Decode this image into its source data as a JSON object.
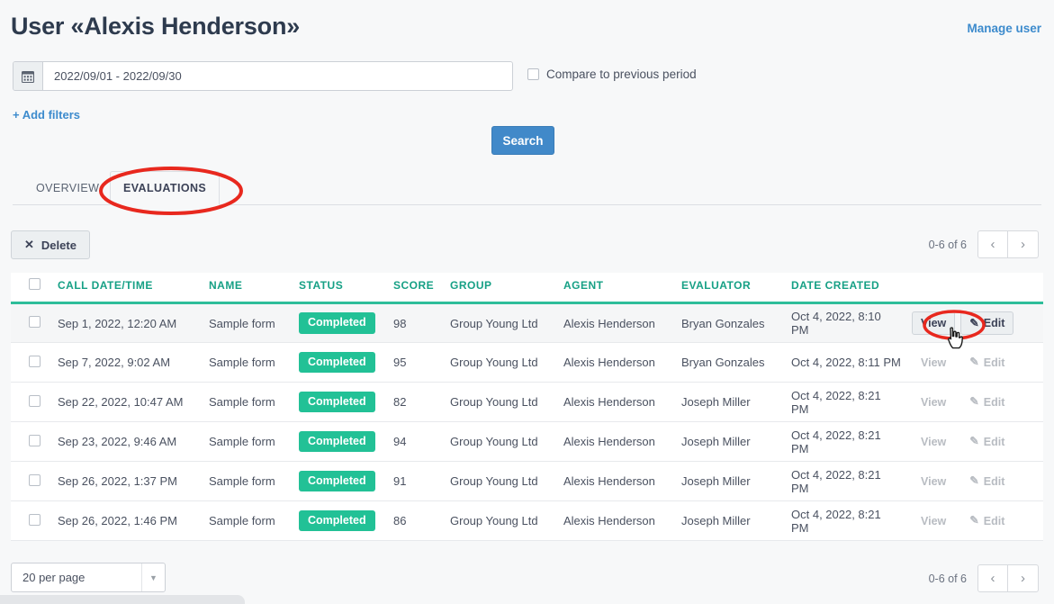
{
  "header": {
    "title": "User «Alexis Henderson»",
    "manage_user_label": "Manage user"
  },
  "filters": {
    "date_range_value": "2022/09/01 - 2022/09/30",
    "date_range_placeholder": "2022/09/01 - 2022/09/30",
    "calendar_icon": "calendar-icon",
    "compare_label": "Compare to previous period",
    "compare_checked": false,
    "add_filters_label": "+ Add filters",
    "search_label": "Search"
  },
  "tabs": [
    {
      "label": "OVERVIEW",
      "active": false
    },
    {
      "label": "EVALUATIONS",
      "active": true
    }
  ],
  "toolbar": {
    "delete_label": "Delete",
    "delete_icon": "x-icon"
  },
  "pagination": {
    "count_label": "0-6 of 6",
    "prev_icon": "chevron-left-icon",
    "next_icon": "chevron-right-icon",
    "per_page_label": "20 per page",
    "per_page_caret": "caret-down-icon"
  },
  "table": {
    "columns": [
      "CALL DATE/TIME",
      "NAME",
      "STATUS",
      "SCORE",
      "GROUP",
      "AGENT",
      "EVALUATOR",
      "DATE CREATED"
    ],
    "actions": {
      "view_label": "View",
      "edit_label": "Edit",
      "edit_icon": "pencil-icon"
    },
    "rows": [
      {
        "call_datetime": "Sep 1, 2022, 12:20 AM",
        "name": "Sample form",
        "status": "Completed",
        "score": "98",
        "group": "Group Young Ltd",
        "agent": "Alexis Henderson",
        "evaluator": "Bryan Gonzales",
        "date_created": "Oct 4, 2022, 8:10 PM",
        "hovered": true
      },
      {
        "call_datetime": "Sep 7, 2022, 9:02 AM",
        "name": "Sample form",
        "status": "Completed",
        "score": "95",
        "group": "Group Young Ltd",
        "agent": "Alexis Henderson",
        "evaluator": "Bryan Gonzales",
        "date_created": "Oct 4, 2022, 8:11 PM",
        "hovered": false
      },
      {
        "call_datetime": "Sep 22, 2022, 10:47 AM",
        "name": "Sample form",
        "status": "Completed",
        "score": "82",
        "group": "Group Young Ltd",
        "agent": "Alexis Henderson",
        "evaluator": "Joseph Miller",
        "date_created": "Oct 4, 2022, 8:21 PM",
        "hovered": false
      },
      {
        "call_datetime": "Sep 23, 2022, 9:46 AM",
        "name": "Sample form",
        "status": "Completed",
        "score": "94",
        "group": "Group Young Ltd",
        "agent": "Alexis Henderson",
        "evaluator": "Joseph Miller",
        "date_created": "Oct 4, 2022, 8:21 PM",
        "hovered": false
      },
      {
        "call_datetime": "Sep 26, 2022, 1:37 PM",
        "name": "Sample form",
        "status": "Completed",
        "score": "91",
        "group": "Group Young Ltd",
        "agent": "Alexis Henderson",
        "evaluator": "Joseph Miller",
        "date_created": "Oct 4, 2022, 8:21 PM",
        "hovered": false
      },
      {
        "call_datetime": "Sep 26, 2022, 1:46 PM",
        "name": "Sample form",
        "status": "Completed",
        "score": "86",
        "group": "Group Young Ltd",
        "agent": "Alexis Henderson",
        "evaluator": "Joseph Miller",
        "date_created": "Oct 4, 2022, 8:21 PM",
        "hovered": false
      }
    ]
  },
  "annotations": {
    "highlight_color": "#e8281e",
    "targets": [
      "evaluations-tab",
      "view-button-row-1"
    ]
  },
  "colors": {
    "accent_teal": "#2ebd9a",
    "badge_green": "#22c196",
    "link_blue": "#3d8bcd",
    "button_blue": "#4189c9",
    "page_background": "#f7f8f9"
  }
}
